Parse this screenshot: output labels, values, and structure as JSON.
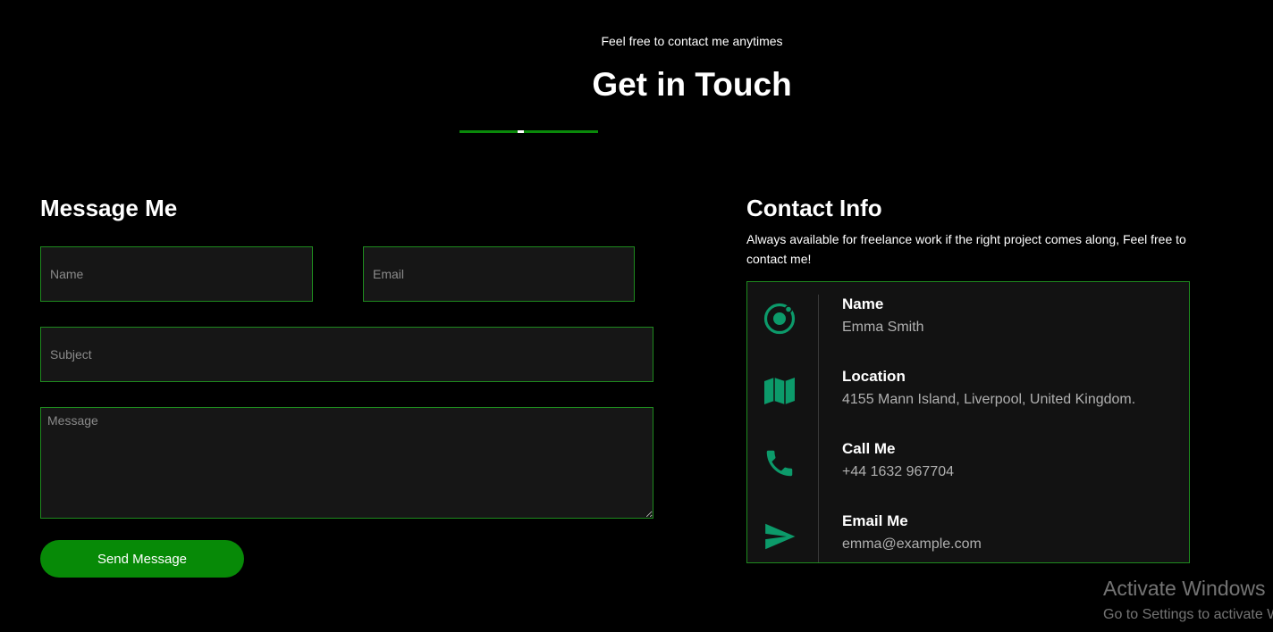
{
  "header": {
    "tagline": "Feel free to contact me anytimes",
    "title": "Get in Touch"
  },
  "message_form": {
    "title": "Message Me",
    "name_placeholder": "Name",
    "email_placeholder": "Email",
    "subject_placeholder": "Subject",
    "message_placeholder": "Message",
    "send_label": "Send Message"
  },
  "contact_info": {
    "title": "Contact Info",
    "description": "Always available for freelance work if the right project comes along, Feel free to contact me!",
    "items": [
      {
        "icon": "ionic-icon",
        "label": "Name",
        "value": "Emma Smith"
      },
      {
        "icon": "map-icon",
        "label": "Location",
        "value": "4155 Mann Island, Liverpool, United Kingdom."
      },
      {
        "icon": "phone-icon",
        "label": "Call Me",
        "value": "+44 1632 967704"
      },
      {
        "icon": "send-icon",
        "label": "Email Me",
        "value": "emma@example.com"
      }
    ]
  },
  "watermark": {
    "title": "Activate Windows",
    "subtitle": "Go to Settings to activate Windows."
  },
  "colors": {
    "background": "#000000",
    "accent_green": "#078a07",
    "border_green": "#1e8a1e",
    "icon_teal": "#0c9a6a"
  }
}
